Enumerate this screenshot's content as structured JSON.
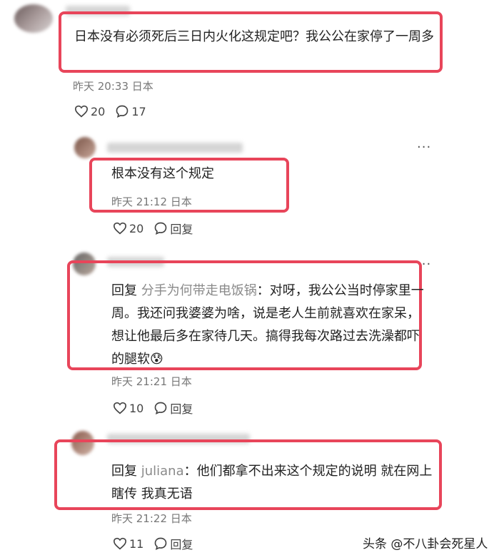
{
  "comments": [
    {
      "text": "日本没有必须死后三日内火化这规定吧？我公公在家停了一周多",
      "meta": "昨天 20:33 日本",
      "likes": "20",
      "replies": "17"
    },
    {
      "text": "根本没有这个规定",
      "meta": "昨天 21:12 日本",
      "likes": "20",
      "reply_label": "回复"
    },
    {
      "reply_keyword": "回复",
      "reply_to": "分手为何带走电饭锅",
      "text": "：对呀，我公公当时停家里一周。我还问我婆婆为啥，说是老人生前就喜欢在家呆，想让他最后多在家待几天。搞得我每次路过去洗澡都吓的腿软",
      "emoji": "😰",
      "meta": "昨天 21:21 日本",
      "likes": "10",
      "reply_label": "回复"
    },
    {
      "reply_keyword": "回复",
      "reply_to": "juliana",
      "text": "：他们都拿不出来这个规定的说明 就在网上瞎传 我真无语",
      "meta": "昨天 21:22 日本",
      "likes": "11",
      "reply_label": "回复"
    }
  ],
  "more_label": "···",
  "watermark": "头条 @不八卦会死星人",
  "accent": "#e8455a"
}
